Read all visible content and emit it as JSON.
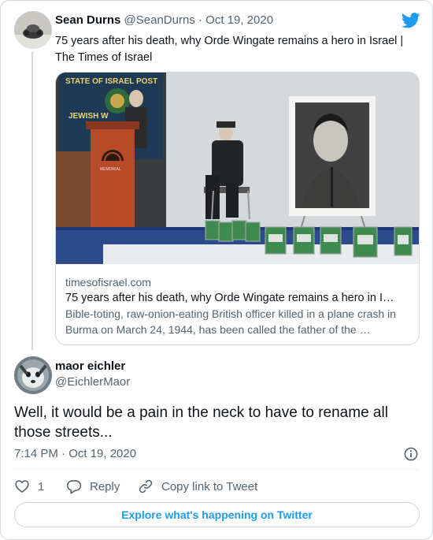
{
  "colors": {
    "accent": "#1d9bf0",
    "text_primary": "#0f1419",
    "text_secondary": "#536471",
    "border": "#cfd9de"
  },
  "parent_tweet": {
    "author_name": "Sean Durns",
    "handle": "@SeanDurns",
    "separator": "·",
    "date": "Oct 19, 2020",
    "text": "75 years after his death, why Orde Wingate remains a hero in Israel | The Times of Israel",
    "logo_icon": "twitter-bird-icon",
    "link_card": {
      "domain": "timesofisrael.com",
      "title": "75 years after his death, why Orde Wingate remains a hero in I…",
      "description": "Bible-toting, raw-onion-eating British officer killed in a plane crash in Burma on March 24, 1944, has been called the father of the …",
      "image_banner_text": "STATE OF ISRAEL POST",
      "image_banner_text_2": "JEWISH W",
      "podium_text": "MEMORIAL"
    }
  },
  "reply_tweet": {
    "author_name": "maor eichler",
    "handle": "@EichlerMaor",
    "text": "Well, it would be a pain in the neck to have to rename all those streets...",
    "timestamp": "7:14 PM · Oct 19, 2020",
    "info_icon": "info-icon"
  },
  "actions": {
    "like_icon": "heart-icon",
    "like_count": "1",
    "reply_icon": "reply-bubble-icon",
    "reply_label": "Reply",
    "copy_icon": "link-icon",
    "copy_label": "Copy link to Tweet"
  },
  "footer": {
    "explore_label": "Explore what's happening on Twitter"
  }
}
